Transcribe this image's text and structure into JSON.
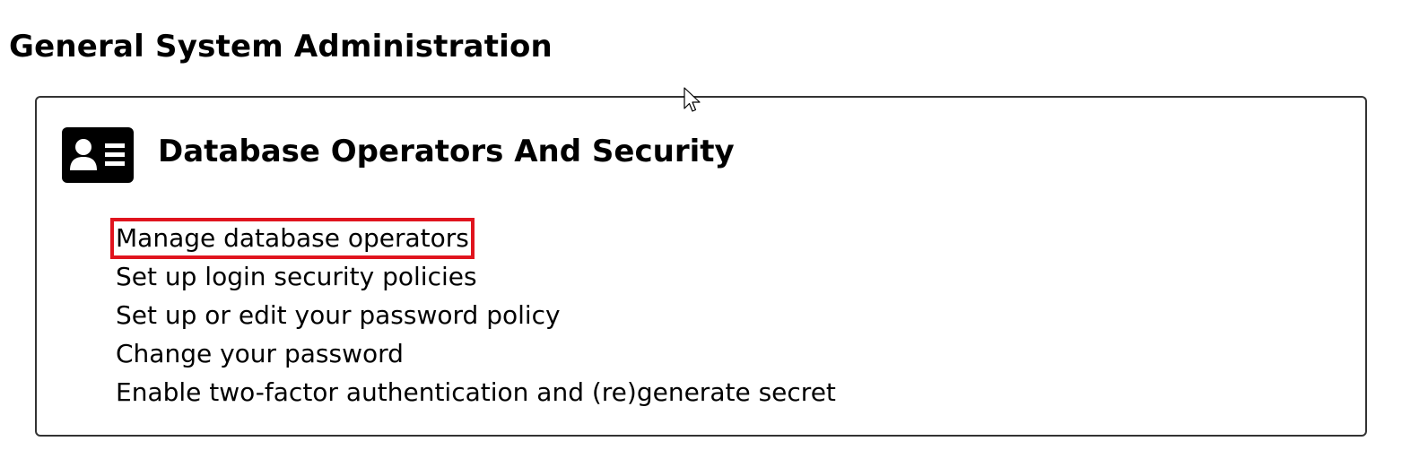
{
  "page": {
    "title": "General System Administration"
  },
  "card": {
    "icon": "id-card-icon",
    "title": "Database Operators And Security",
    "links": [
      {
        "label": "Manage database operators",
        "highlighted": true
      },
      {
        "label": "Set up login security policies",
        "highlighted": false
      },
      {
        "label": "Set up or edit your password policy",
        "highlighted": false
      },
      {
        "label": "Change your password",
        "highlighted": false
      },
      {
        "label": "Enable two-factor authentication and (re)generate secret",
        "highlighted": false
      }
    ]
  },
  "colors": {
    "highlight_border": "#e0141e",
    "card_border": "#333333",
    "icon_fill": "#000000"
  },
  "cursor": {
    "icon": "mouse-pointer-icon"
  }
}
